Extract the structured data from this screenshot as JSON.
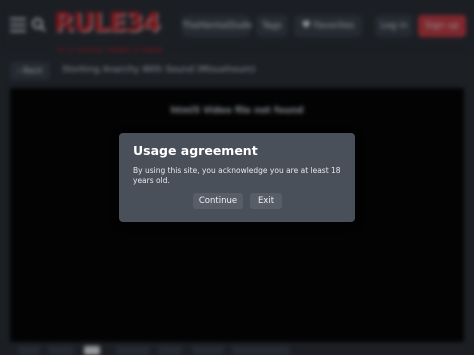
{
  "header": {
    "logo_text": "RULE34",
    "logo_tagline": "IF IT EXISTS THERE IS PORN",
    "nav": [
      {
        "label": "TheHentaiDude"
      },
      {
        "label": "Tags"
      },
      {
        "label": "Favorites"
      }
    ],
    "login_label": "Log in",
    "signup_label": "Sign up"
  },
  "content": {
    "back_label": "‹ Back",
    "video_title": "Storking Anarchy With Sound (Misuehoum)",
    "video_message": "html5 Video file not found"
  },
  "modal": {
    "title": "Usage agreement",
    "text": "By using this site, you acknowledge you are at least 18 years old.",
    "continue_label": "Continue",
    "exit_label": "Exit"
  },
  "colors": {
    "accent": "#c43d47",
    "modal_bg": "#4a5059",
    "page_bg": "#2b3038"
  }
}
